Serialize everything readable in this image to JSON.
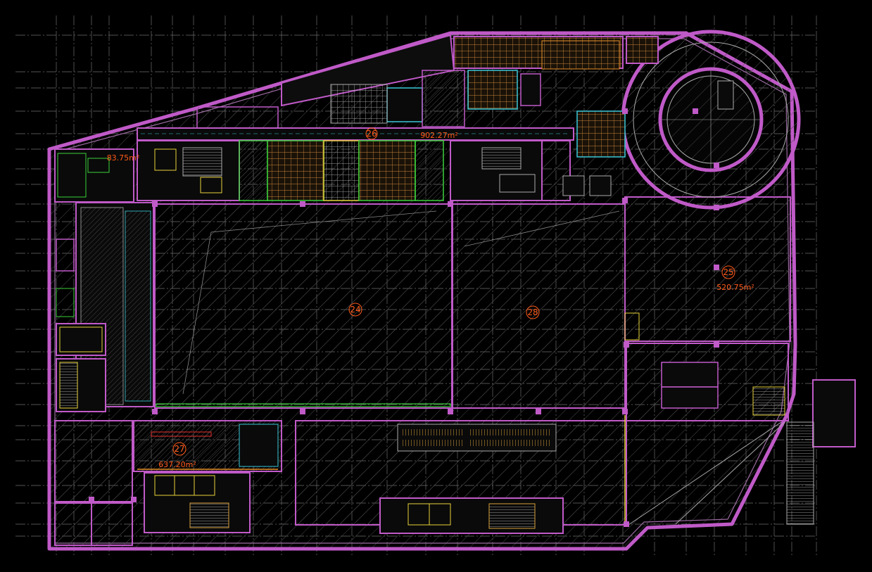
{
  "drawing": {
    "background": "#000000",
    "colors": {
      "wall": "#c05ac8",
      "wall_light": "#d47ad8",
      "grid": "#8a8a8a",
      "hatch": "#5a5a5a",
      "label": "#ff5a1a",
      "green": "#3ad13a",
      "yellow": "#e8d23a",
      "cyan": "#39c8d8",
      "orange": "#e8902a",
      "white": "#e0e0e0",
      "blue": "#3b6fd8",
      "red": "#e83030"
    },
    "zones": [
      {
        "id": "24",
        "area": ""
      },
      {
        "id": "28",
        "area": ""
      },
      {
        "id": "25",
        "area": "520.75m²"
      },
      {
        "id": "26",
        "area": "902.27m²"
      },
      {
        "id": "27",
        "area": "637.20m²"
      },
      {
        "id": "",
        "area": "83.75m²"
      }
    ]
  }
}
